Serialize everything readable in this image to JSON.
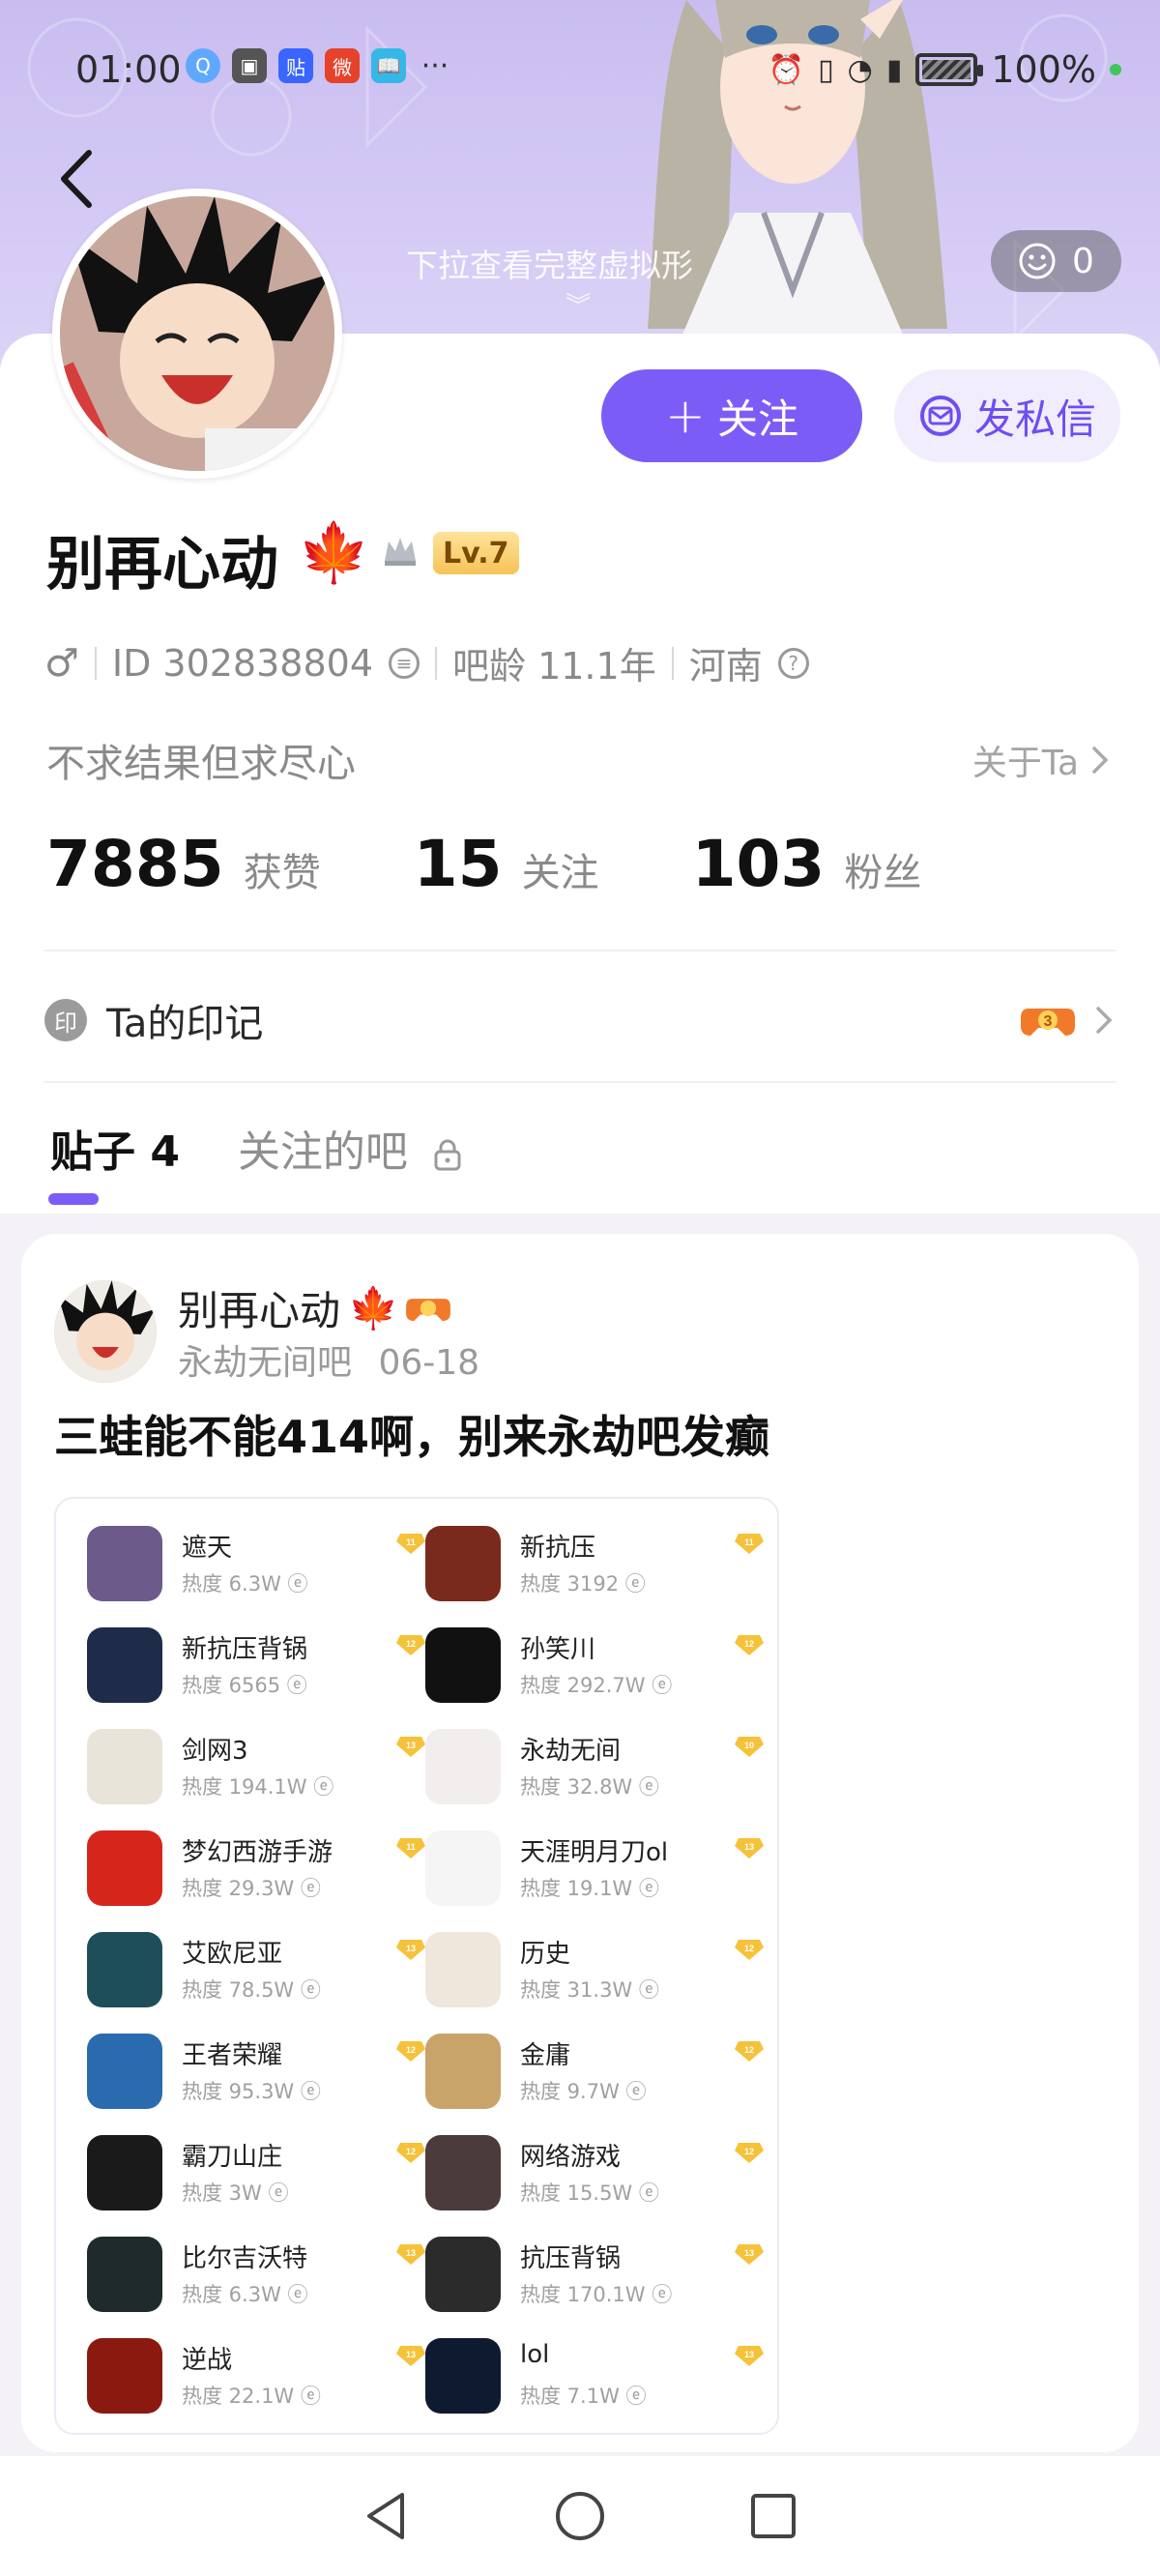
{
  "status_bar": {
    "time": "01:00",
    "battery": "100%"
  },
  "header": {
    "pull_hint": "下拉查看完整虚拟形",
    "visitor_count": "0"
  },
  "actions": {
    "follow_label": "关注",
    "dm_label": "发私信"
  },
  "profile": {
    "name": "别再心动",
    "level": "Lv.7",
    "id": "ID 302838804",
    "age": "吧龄 11.1年",
    "location": "河南",
    "bio": "不求结果但求尽心",
    "about_label": "关于Ta"
  },
  "stats": [
    {
      "value": "7885",
      "label": "获赞"
    },
    {
      "value": "15",
      "label": "关注"
    },
    {
      "value": "103",
      "label": "粉丝"
    }
  ],
  "badges": {
    "title": "Ta的印记",
    "icon_char": "印"
  },
  "tabs": {
    "posts": "贴子 4",
    "followed_bars": "关注的吧"
  },
  "post": {
    "author": "别再心动",
    "forum": "永劫无间吧",
    "date": "06-18",
    "title": "三蛙能不能414啊，别来永劫吧发癫"
  },
  "forums": [
    {
      "name": "遮天",
      "heat": "热度 6.3W",
      "level": "11",
      "color": "#6b5a8a"
    },
    {
      "name": "新抗压",
      "heat": "热度 3192",
      "level": "11",
      "color": "#7a2a1c"
    },
    {
      "name": "新抗压背锅",
      "heat": "热度 6565",
      "level": "12",
      "color": "#1e2c4a"
    },
    {
      "name": "孙笑川",
      "heat": "热度 292.7W",
      "level": "12",
      "color": "#111111"
    },
    {
      "name": "剑网3",
      "heat": "热度 194.1W",
      "level": "13",
      "color": "#e9e4da"
    },
    {
      "name": "永劫无间",
      "heat": "热度 32.8W",
      "level": "10",
      "color": "#f3eeee"
    },
    {
      "name": "梦幻西游手游",
      "heat": "热度 29.3W",
      "level": "11",
      "color": "#d6261c"
    },
    {
      "name": "天涯明月刀ol",
      "heat": "热度 19.1W",
      "level": "13",
      "color": "#f5f5f5"
    },
    {
      "name": "艾欧尼亚",
      "heat": "热度 78.5W",
      "level": "13",
      "color": "#1d4e5a"
    },
    {
      "name": "历史",
      "heat": "热度 31.3W",
      "level": "12",
      "color": "#efe7db"
    },
    {
      "name": "王者荣耀",
      "heat": "热度 95.3W",
      "level": "12",
      "color": "#2a6bb0"
    },
    {
      "name": "金庸",
      "heat": "热度 9.7W",
      "level": "12",
      "color": "#c9a46a"
    },
    {
      "name": "霸刀山庄",
      "heat": "热度 3W",
      "level": "12",
      "color": "#1a1a1a"
    },
    {
      "name": "网络游戏",
      "heat": "热度 15.5W",
      "level": "12",
      "color": "#4b3b3b"
    },
    {
      "name": "比尔吉沃特",
      "heat": "热度 6.3W",
      "level": "13",
      "color": "#1f2a2a"
    },
    {
      "name": "抗压背锅",
      "heat": "热度 170.1W",
      "level": "13",
      "color": "#2b2b2b"
    },
    {
      "name": "逆战",
      "heat": "热度 22.1W",
      "level": "13",
      "color": "#8a1a10"
    },
    {
      "name": "lol",
      "heat": "热度 7.1W",
      "level": "13",
      "color": "#0e1a30"
    }
  ],
  "colors": {
    "accent": "#7c5cf6",
    "banner": "#d2c6f4",
    "gem": "#f5c23a"
  }
}
